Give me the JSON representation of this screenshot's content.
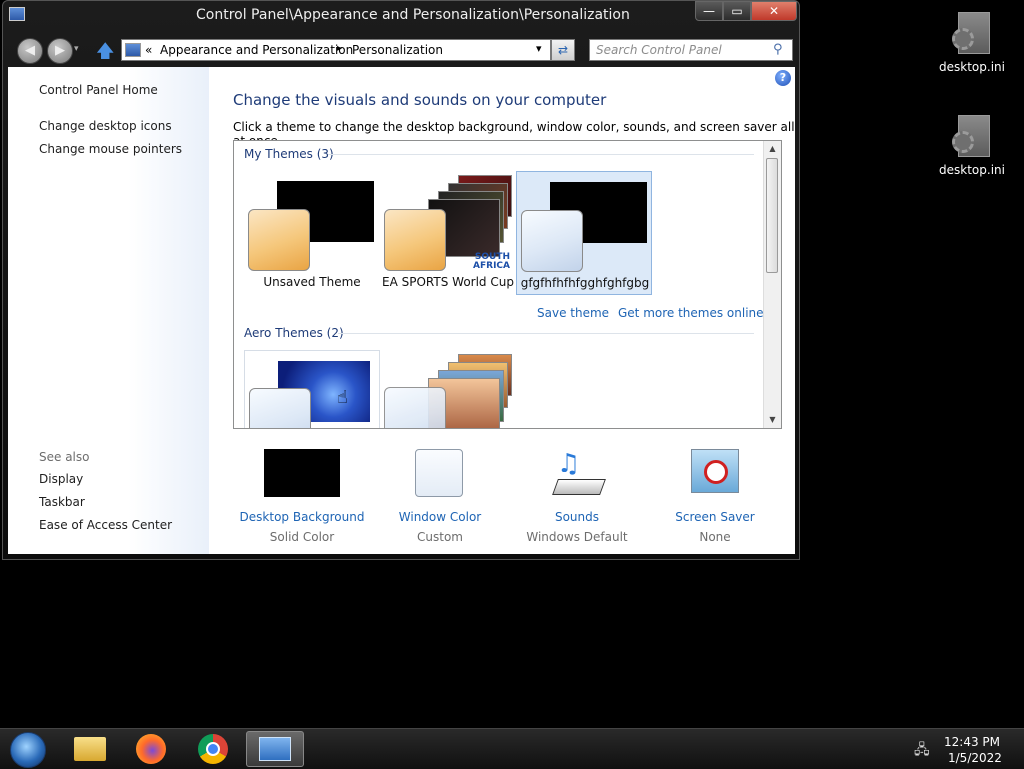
{
  "window": {
    "title": "Control Panel\\Appearance and Personalization\\Personalization",
    "controls": {
      "minimize": "—",
      "maximize": "▭",
      "close": "✕"
    }
  },
  "address": {
    "crumbs": [
      "Appearance and Personalization",
      "Personalization"
    ],
    "overflow": "«",
    "separator": "▸",
    "dropdown": "▾"
  },
  "search": {
    "placeholder": "Search Control Panel"
  },
  "sidebar": {
    "home": "Control Panel Home",
    "tasks": [
      "Change desktop icons",
      "Change mouse pointers"
    ],
    "see_also_label": "See also",
    "see_also": [
      "Display",
      "Taskbar",
      "Ease of Access Center"
    ]
  },
  "main": {
    "title": "Change the visuals and sounds on your computer",
    "subtitle": "Click a theme to change the desktop background, window color, sounds, and screen saver all at once.",
    "my_themes_header": "My Themes (3)",
    "my_themes": [
      {
        "name": "Unsaved Theme"
      },
      {
        "name": "EA SPORTS World Cup"
      },
      {
        "name": "gfgfhfhfhfgghfghfgbg"
      }
    ],
    "ea_logo": "SOUTH AFRICA",
    "save_theme": "Save theme",
    "get_more": "Get more themes online",
    "aero_themes_header": "Aero Themes (2)"
  },
  "bottom": [
    {
      "label": "Desktop Background",
      "value": "Solid Color"
    },
    {
      "label": "Window Color",
      "value": "Custom"
    },
    {
      "label": "Sounds",
      "value": "Windows Default"
    },
    {
      "label": "Screen Saver",
      "value": "None"
    }
  ],
  "desktop": {
    "icons": [
      "desktop.ini",
      "desktop.ini"
    ]
  },
  "taskbar": {
    "time": "12:43 PM",
    "date": "1/5/2022"
  },
  "colors": {
    "link": "#1e64b4",
    "heading": "#1e3b78",
    "selected": "#dce9f8"
  }
}
